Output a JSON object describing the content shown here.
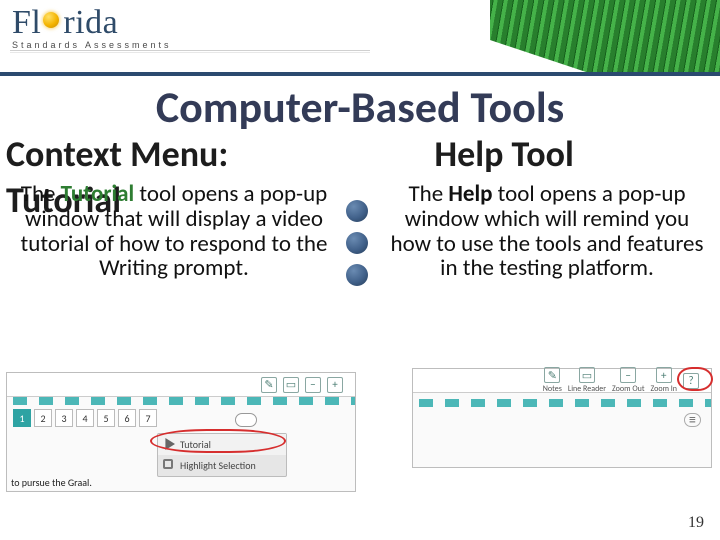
{
  "header": {
    "brand_word_prefix": "Fl",
    "brand_word_mid": "o",
    "brand_word_suffix": "rida",
    "brand_sub": "Standards Assessments"
  },
  "title": "Computer-Based Tools",
  "left": {
    "heading": "Context Menu:",
    "overlay": "Tutorial",
    "para_prefix": "The ",
    "para_kw": "Tutorial",
    "para_rest": " tool opens a pop-up window that will display a video tutorial of how to respond to the Writing prompt."
  },
  "right": {
    "heading": "Help Tool",
    "para_prefix": "The ",
    "para_kw": "Help",
    "para_rest": " tool opens a pop-up window which will remind you how to use the tools and features in the testing platform."
  },
  "shot_left": {
    "toolbar_icons": [
      "✎",
      "▭",
      "−",
      "+"
    ],
    "pages": [
      "1",
      "2",
      "3",
      "4",
      "5",
      "6",
      "7"
    ],
    "active_page": "1",
    "ctx_items": [
      {
        "icon": "tut",
        "label": "Tutorial"
      },
      {
        "icon": "hl",
        "label": "Highlight Selection"
      }
    ],
    "snippet": "to pursue the Graal."
  },
  "shot_right": {
    "toolbar": [
      {
        "icon": "✎",
        "label": "Notes"
      },
      {
        "icon": "▭",
        "label": "Line Reader"
      },
      {
        "icon": "−",
        "label": "Zoom Out"
      },
      {
        "icon": "+",
        "label": "Zoom In"
      },
      {
        "icon": "?",
        "label": ""
      }
    ]
  },
  "page_number": "19"
}
